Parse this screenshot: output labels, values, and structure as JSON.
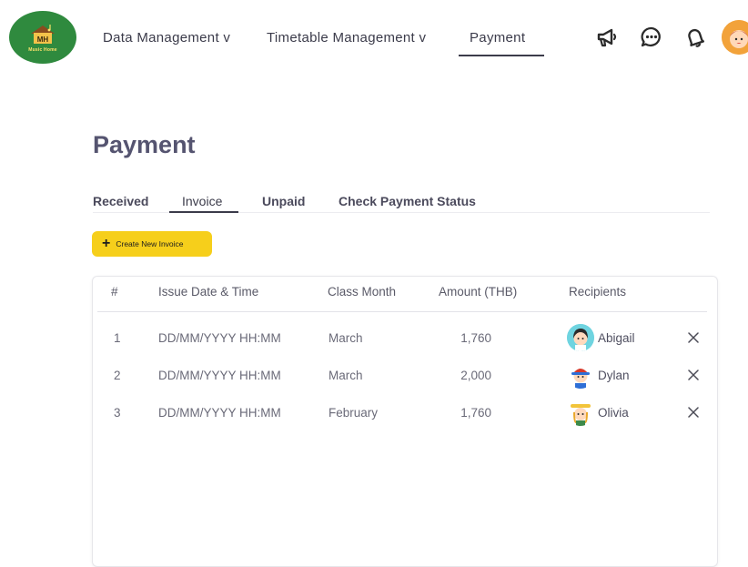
{
  "logo": {
    "initials": "MH",
    "name": "Music Home"
  },
  "nav": {
    "items": [
      {
        "label": "Data Management v"
      },
      {
        "label": "Timetable Management v"
      },
      {
        "label": "Payment"
      }
    ],
    "active": "Payment"
  },
  "header_icons": [
    "megaphone-icon",
    "chat-icon",
    "bell-icon",
    "avatar"
  ],
  "page": {
    "title": "Payment"
  },
  "tabs": {
    "items": [
      {
        "label": "Received"
      },
      {
        "label": "Invoice"
      },
      {
        "label": "Unpaid"
      },
      {
        "label": "Check Payment Status"
      }
    ],
    "active": "Invoice"
  },
  "create_button": {
    "label": "Create New Invoice",
    "icon": "plus-icon"
  },
  "table": {
    "columns": [
      "#",
      "Issue Date & Time",
      "Class Month",
      "Amount (THB)",
      "Recipients"
    ],
    "rows": [
      {
        "num": "1",
        "datetime": "DD/MM/YYYY HH:MM",
        "month": "March",
        "amount": "1,760",
        "recipient": "Abigail"
      },
      {
        "num": "2",
        "datetime": "DD/MM/YYYY HH:MM",
        "month": "March",
        "amount": "2,000",
        "recipient": "Dylan"
      },
      {
        "num": "3",
        "datetime": "DD/MM/YYYY HH:MM",
        "month": "February",
        "amount": "1,760",
        "recipient": "Olivia"
      }
    ],
    "row_action_icon": "close-icon"
  },
  "colors": {
    "accent_yellow": "#f6cf1b",
    "logo_green": "#2f8a3e",
    "title": "#555470",
    "text": "#3b3b4a"
  }
}
